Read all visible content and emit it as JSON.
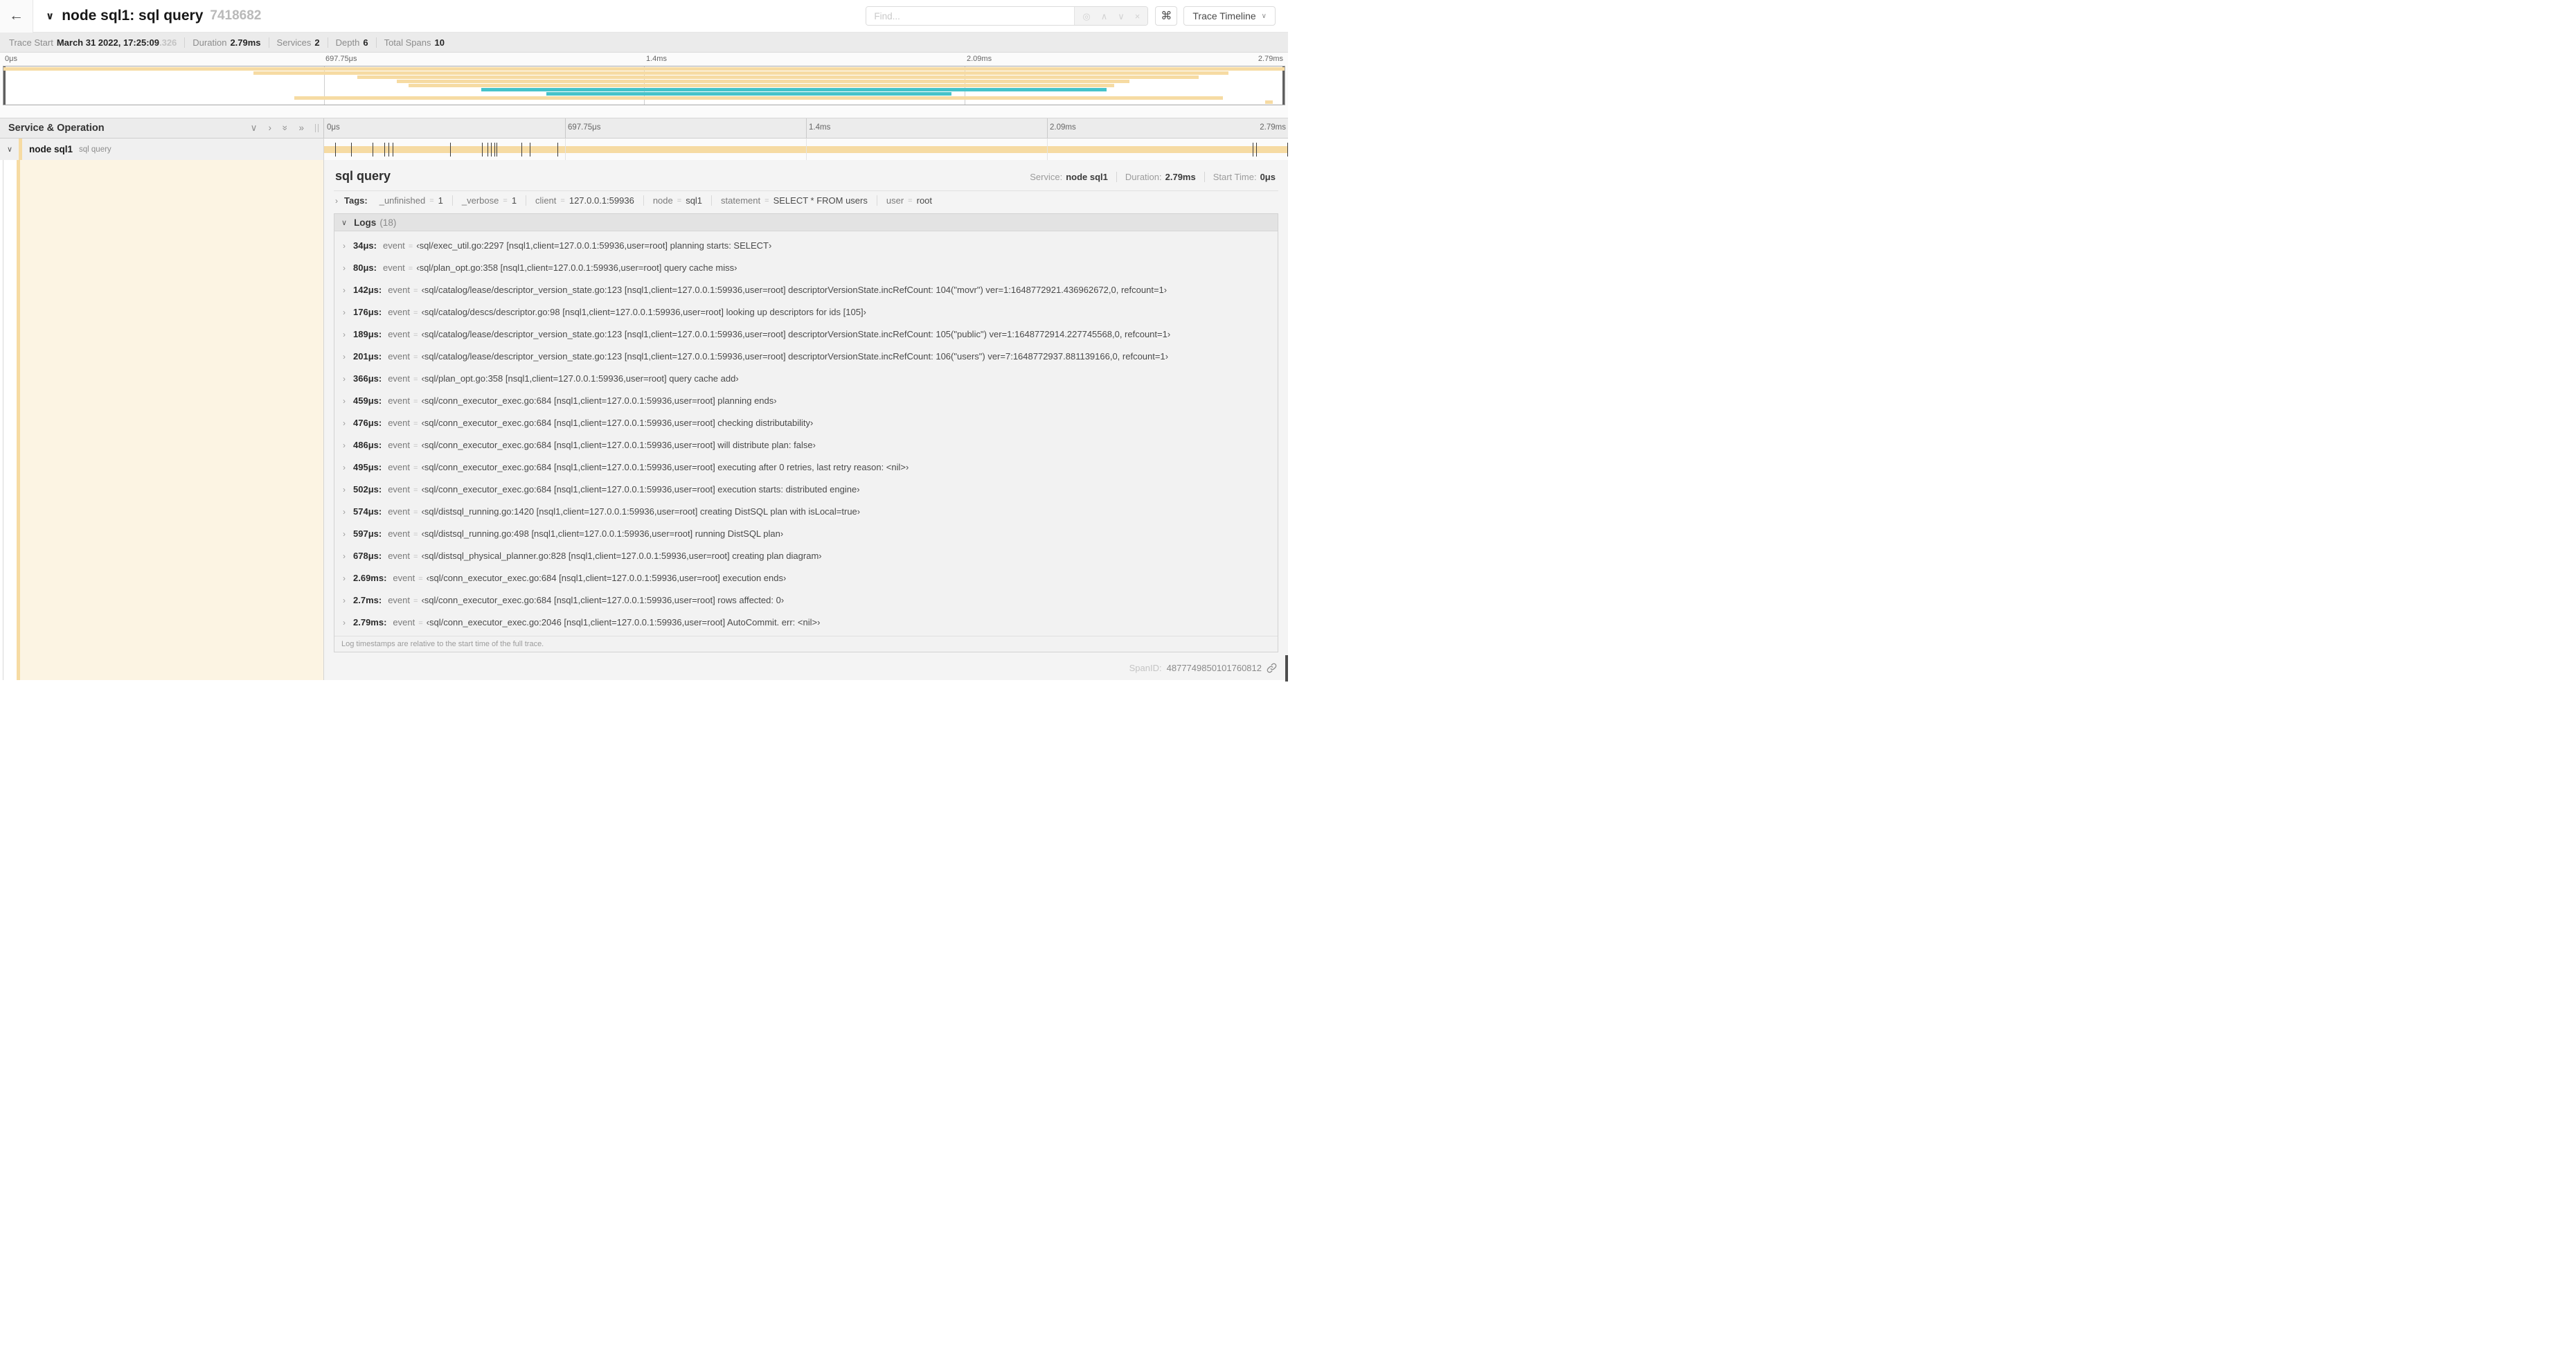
{
  "header": {
    "title": "node sql1: sql query",
    "trace_id": "7418682",
    "find_placeholder": "Find...",
    "view_label": "Trace Timeline"
  },
  "icons": {
    "back": "←",
    "chevron_down": "∨",
    "chevron_right": "›",
    "double_chevron_right": "»",
    "chevron_up": "∧",
    "locate": "◎",
    "close": "×",
    "command": "⌘"
  },
  "trace_info": {
    "items": [
      {
        "label": "Trace Start",
        "value": "March 31 2022, 17:25:09",
        "dim": ".326"
      },
      {
        "label": "Duration",
        "value": "2.79ms"
      },
      {
        "label": "Services",
        "value": "2"
      },
      {
        "label": "Depth",
        "value": "6"
      },
      {
        "label": "Total Spans",
        "value": "10"
      }
    ]
  },
  "minimap": {
    "tick_labels": [
      "0μs",
      "697.75μs",
      "1.4ms",
      "2.09ms",
      "2.79ms"
    ],
    "colors": {
      "tan": "#F6DBA3",
      "teal": "#46C3CA"
    },
    "spans": [
      {
        "s": 0.0,
        "e": 1.0,
        "c": "tan"
      },
      {
        "s": 0.195,
        "e": 0.956,
        "c": "tan"
      },
      {
        "s": 0.276,
        "e": 0.933,
        "c": "tan"
      },
      {
        "s": 0.307,
        "e": 0.879,
        "c": "tan"
      },
      {
        "s": 0.316,
        "e": 0.867,
        "c": "tan"
      },
      {
        "s": 0.373,
        "e": 0.861,
        "c": "teal"
      },
      {
        "s": 0.424,
        "e": 0.74,
        "c": "teal"
      },
      {
        "s": 0.227,
        "e": 0.952,
        "c": "tan"
      },
      {
        "s": 0.985,
        "e": 0.991,
        "c": "tan"
      }
    ]
  },
  "timeline": {
    "left_title": "Service & Operation",
    "tick_labels": [
      "0μs",
      "697.75μs",
      "1.4ms",
      "2.09ms",
      "2.79ms"
    ]
  },
  "span_row": {
    "service": "node sql1",
    "operation": "sql query",
    "total_us": 2790,
    "tick_times_us": [
      34,
      80,
      142,
      176,
      189,
      201,
      366,
      459,
      476,
      486,
      495,
      502,
      574,
      597,
      678,
      2690,
      2700,
      2790
    ]
  },
  "detail": {
    "title": "sql query",
    "stats": [
      {
        "label": "Service:",
        "value": "node sql1"
      },
      {
        "label": "Duration:",
        "value": "2.79ms"
      },
      {
        "label": "Start Time:",
        "value": "0μs"
      }
    ],
    "tags": {
      "label": "Tags:",
      "items": [
        {
          "key": "_unfinished",
          "value": "1"
        },
        {
          "key": "_verbose",
          "value": "1"
        },
        {
          "key": "client",
          "value": "127.0.0.1:59936"
        },
        {
          "key": "node",
          "value": "sql1"
        },
        {
          "key": "statement",
          "value": "SELECT * FROM users"
        },
        {
          "key": "user",
          "value": "root"
        }
      ]
    },
    "logs": {
      "label": "Logs",
      "count": "(18)",
      "field_key": "event",
      "entries": [
        {
          "ts": "34μs:",
          "msg": "‹sql/exec_util.go:2297 [nsql1,client=127.0.0.1:59936,user=root] planning starts: SELECT›"
        },
        {
          "ts": "80μs:",
          "msg": "‹sql/plan_opt.go:358 [nsql1,client=127.0.0.1:59936,user=root] query cache miss›"
        },
        {
          "ts": "142μs:",
          "msg": "‹sql/catalog/lease/descriptor_version_state.go:123 [nsql1,client=127.0.0.1:59936,user=root] descriptorVersionState.incRefCount: 104(\"movr\") ver=1:1648772921.436962672,0, refcount=1›"
        },
        {
          "ts": "176μs:",
          "msg": "‹sql/catalog/descs/descriptor.go:98 [nsql1,client=127.0.0.1:59936,user=root] looking up descriptors for ids [105]›"
        },
        {
          "ts": "189μs:",
          "msg": "‹sql/catalog/lease/descriptor_version_state.go:123 [nsql1,client=127.0.0.1:59936,user=root] descriptorVersionState.incRefCount: 105(\"public\") ver=1:1648772914.227745568,0, refcount=1›"
        },
        {
          "ts": "201μs:",
          "msg": "‹sql/catalog/lease/descriptor_version_state.go:123 [nsql1,client=127.0.0.1:59936,user=root] descriptorVersionState.incRefCount: 106(\"users\") ver=7:1648772937.881139166,0, refcount=1›"
        },
        {
          "ts": "366μs:",
          "msg": "‹sql/plan_opt.go:358 [nsql1,client=127.0.0.1:59936,user=root] query cache add›"
        },
        {
          "ts": "459μs:",
          "msg": "‹sql/conn_executor_exec.go:684 [nsql1,client=127.0.0.1:59936,user=root] planning ends›"
        },
        {
          "ts": "476μs:",
          "msg": "‹sql/conn_executor_exec.go:684 [nsql1,client=127.0.0.1:59936,user=root] checking distributability›"
        },
        {
          "ts": "486μs:",
          "msg": "‹sql/conn_executor_exec.go:684 [nsql1,client=127.0.0.1:59936,user=root] will distribute plan: false›"
        },
        {
          "ts": "495μs:",
          "msg": "‹sql/conn_executor_exec.go:684 [nsql1,client=127.0.0.1:59936,user=root] executing after 0 retries, last retry reason: <nil>›"
        },
        {
          "ts": "502μs:",
          "msg": "‹sql/conn_executor_exec.go:684 [nsql1,client=127.0.0.1:59936,user=root] execution starts: distributed engine›"
        },
        {
          "ts": "574μs:",
          "msg": "‹sql/distsql_running.go:1420 [nsql1,client=127.0.0.1:59936,user=root] creating DistSQL plan with isLocal=true›"
        },
        {
          "ts": "597μs:",
          "msg": "‹sql/distsql_running.go:498 [nsql1,client=127.0.0.1:59936,user=root] running DistSQL plan›"
        },
        {
          "ts": "678μs:",
          "msg": "‹sql/distsql_physical_planner.go:828 [nsql1,client=127.0.0.1:59936,user=root] creating plan diagram›"
        },
        {
          "ts": "2.69ms:",
          "msg": "‹sql/conn_executor_exec.go:684 [nsql1,client=127.0.0.1:59936,user=root] execution ends›"
        },
        {
          "ts": "2.7ms:",
          "msg": "‹sql/conn_executor_exec.go:684 [nsql1,client=127.0.0.1:59936,user=root] rows affected: 0›"
        },
        {
          "ts": "2.79ms:",
          "msg": "‹sql/conn_executor_exec.go:2046 [nsql1,client=127.0.0.1:59936,user=root] AutoCommit. err: <nil>›"
        }
      ],
      "footer": "Log timestamps are relative to the start time of the full trace."
    },
    "span_id_label": "SpanID:",
    "span_id": "4877749850101760812"
  }
}
